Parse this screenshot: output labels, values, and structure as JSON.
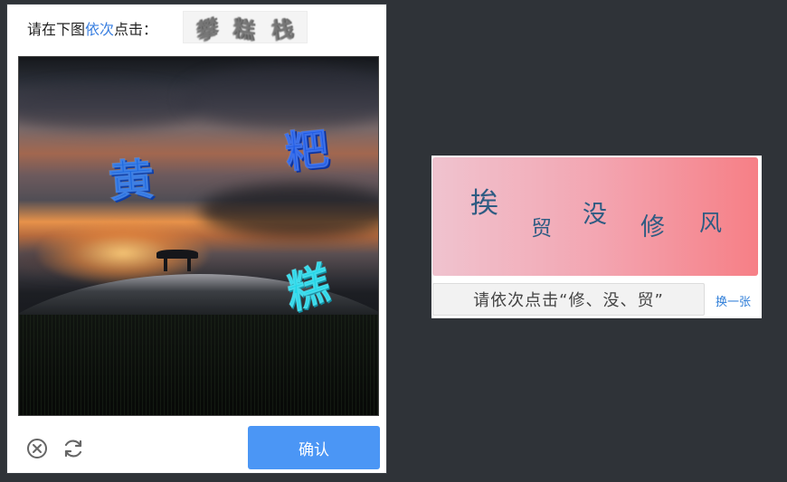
{
  "left_captcha": {
    "prompt": {
      "prefix": "请在下图",
      "highlight": "依次",
      "suffix": "点击：",
      "target_chars": [
        "攀",
        "糕",
        "栈"
      ]
    },
    "scene_chars": [
      "黄",
      "粑",
      "糕"
    ],
    "confirm_label": "确认",
    "colors": {
      "accent": "#4b96f5",
      "highlight_text": "#3a7fe0"
    },
    "icons": [
      "close-circle-icon",
      "refresh-icon"
    ]
  },
  "right_captcha": {
    "image_chars": [
      "挨",
      "贸",
      "没",
      "修",
      "风"
    ],
    "prompt": "请依次点击“修、没、贸”",
    "refresh_label": "换一张",
    "colors": {
      "char_color": "#2f5c83",
      "link": "#2f7ed8"
    }
  }
}
